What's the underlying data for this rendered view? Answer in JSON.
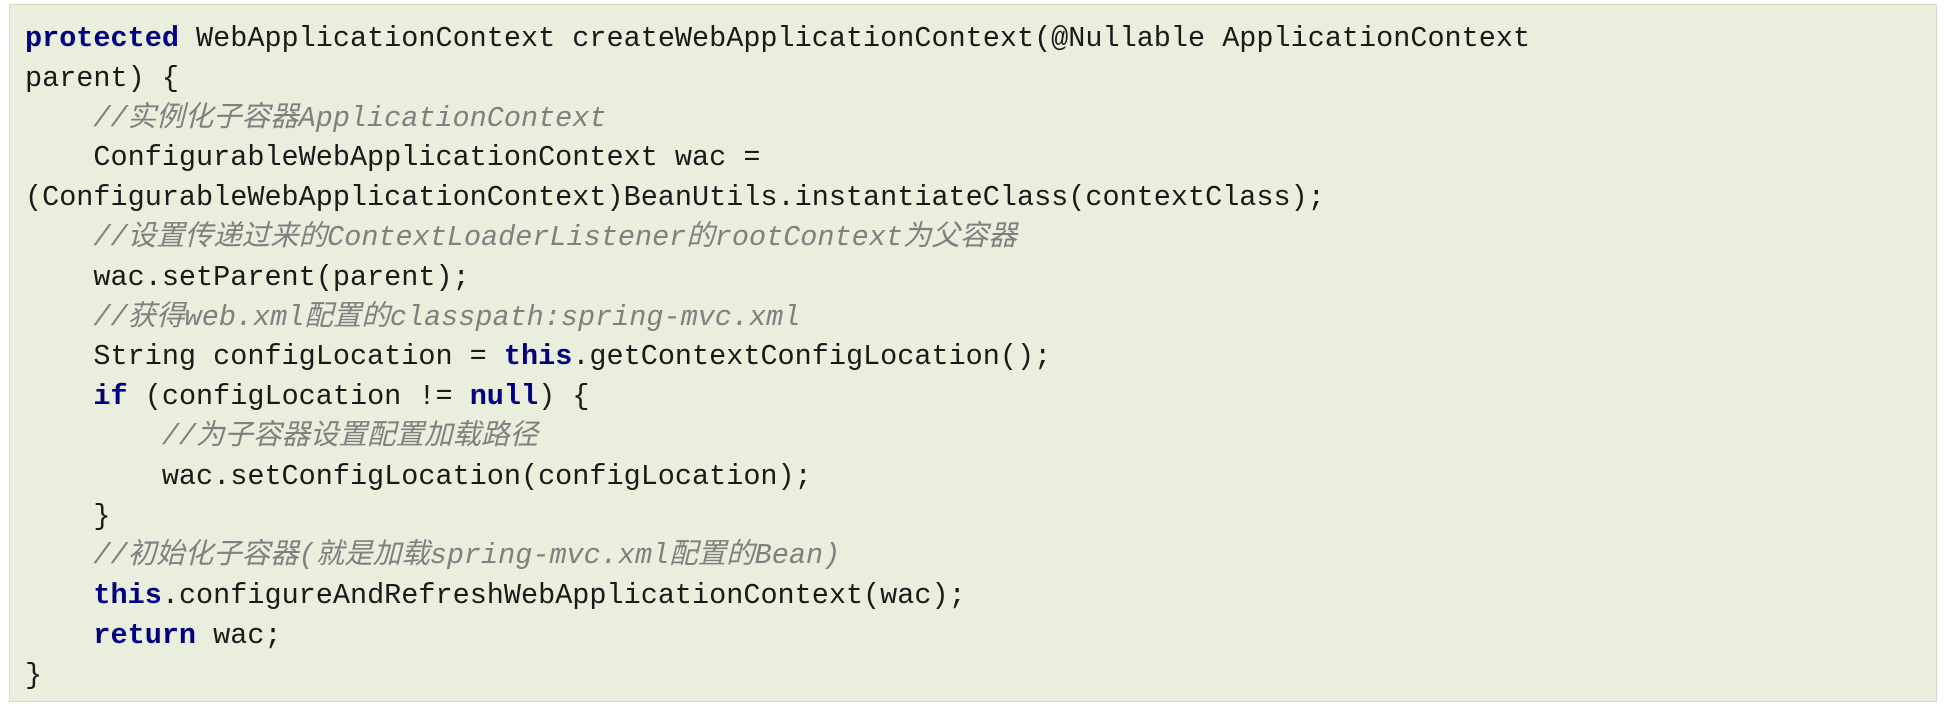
{
  "code": {
    "lines": [
      [
        {
          "t": "protected",
          "k": "kw"
        },
        {
          "t": " WebApplicationContext createWebApplicationContext(@Nullable ApplicationContext",
          "k": "pl"
        }
      ],
      [
        {
          "t": "parent) {",
          "k": "pl"
        }
      ],
      [
        {
          "t": "    ",
          "k": "pl"
        },
        {
          "t": "//实例化子容器ApplicationContext",
          "k": "cm"
        }
      ],
      [
        {
          "t": "    ConfigurableWebApplicationContext wac =",
          "k": "pl"
        }
      ],
      [
        {
          "t": "(ConfigurableWebApplicationContext)BeanUtils.instantiateClass(contextClass);",
          "k": "pl"
        }
      ],
      [
        {
          "t": "    ",
          "k": "pl"
        },
        {
          "t": "//设置传递过来的ContextLoaderListener的rootContext为父容器",
          "k": "cm"
        }
      ],
      [
        {
          "t": "    wac.setParent(parent);",
          "k": "pl"
        }
      ],
      [
        {
          "t": "    ",
          "k": "pl"
        },
        {
          "t": "//获得web.xml配置的classpath:spring-mvc.xml",
          "k": "cm"
        }
      ],
      [
        {
          "t": "    String configLocation = ",
          "k": "pl"
        },
        {
          "t": "this",
          "k": "kw"
        },
        {
          "t": ".getContextConfigLocation();",
          "k": "pl"
        }
      ],
      [
        {
          "t": "    ",
          "k": "pl"
        },
        {
          "t": "if",
          "k": "kw"
        },
        {
          "t": " (configLocation != ",
          "k": "pl"
        },
        {
          "t": "null",
          "k": "kw"
        },
        {
          "t": ") {",
          "k": "pl"
        }
      ],
      [
        {
          "t": "        ",
          "k": "pl"
        },
        {
          "t": "//为子容器设置配置加载路径",
          "k": "cm"
        }
      ],
      [
        {
          "t": "        wac.setConfigLocation(configLocation);",
          "k": "pl"
        }
      ],
      [
        {
          "t": "    }",
          "k": "pl"
        }
      ],
      [
        {
          "t": "    ",
          "k": "pl"
        },
        {
          "t": "//初始化子容器(就是加载spring-mvc.xml配置的Bean)",
          "k": "cm"
        }
      ],
      [
        {
          "t": "    ",
          "k": "pl"
        },
        {
          "t": "this",
          "k": "kw"
        },
        {
          "t": ".configureAndRefreshWebApplicationContext(wac);",
          "k": "pl"
        }
      ],
      [
        {
          "t": "    ",
          "k": "pl"
        },
        {
          "t": "return",
          "k": "kw"
        },
        {
          "t": " wac;",
          "k": "pl"
        }
      ],
      [
        {
          "t": "}",
          "k": "pl"
        }
      ]
    ]
  },
  "colors": {
    "background": "#eaeedc",
    "keyword": "#000080",
    "comment": "#808080",
    "text": "#1a1a1a"
  }
}
